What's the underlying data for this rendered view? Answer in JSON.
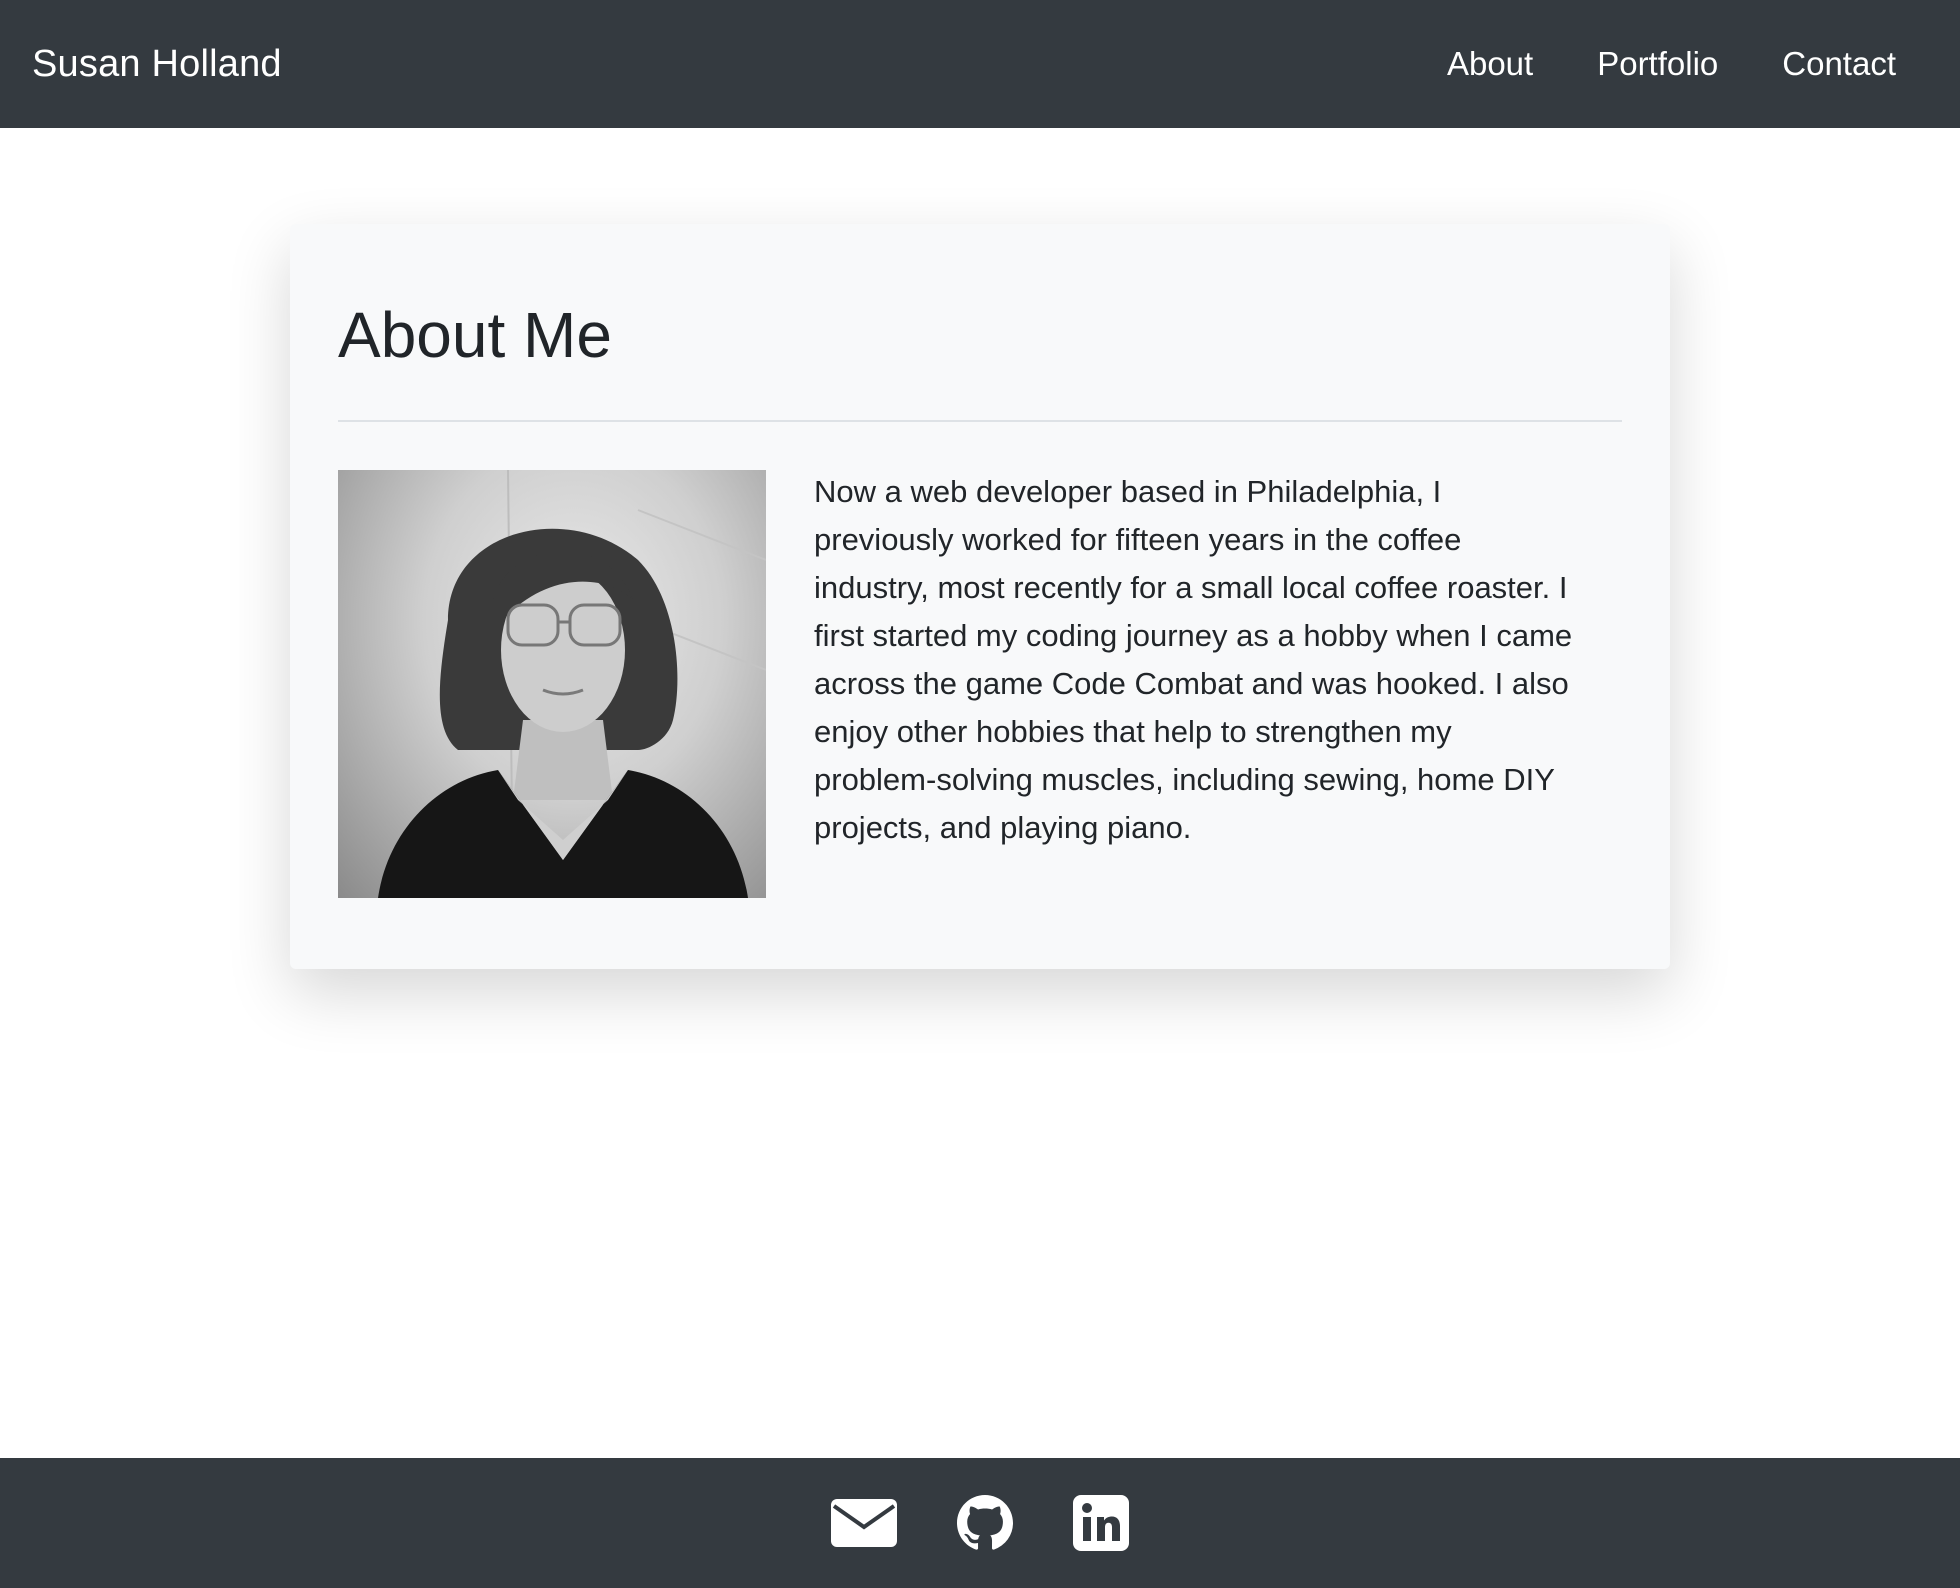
{
  "navbar": {
    "brand": "Susan Holland",
    "links": [
      {
        "label": "About"
      },
      {
        "label": "Portfolio"
      },
      {
        "label": "Contact"
      }
    ]
  },
  "about": {
    "title": "About Me",
    "photo_alt": "Portrait of Susan Holland",
    "bio": "Now a web developer based in Philadelphia, I previously worked for fifteen years in the coffee industry, most recently for a small local coffee roaster. I first started my coding journey as a hobby when I came across the game Code Combat and was hooked. I also enjoy other hobbies that help to strengthen my problem-solving muscles, including sewing, home DIY projects, and playing piano."
  },
  "footer": {
    "icons": [
      {
        "name": "envelope-icon"
      },
      {
        "name": "github-icon"
      },
      {
        "name": "linkedin-icon"
      }
    ]
  },
  "colors": {
    "navbar_bg": "#343a40",
    "card_bg": "#f8f9fa",
    "text": "#212529",
    "nav_text": "#ffffff"
  }
}
